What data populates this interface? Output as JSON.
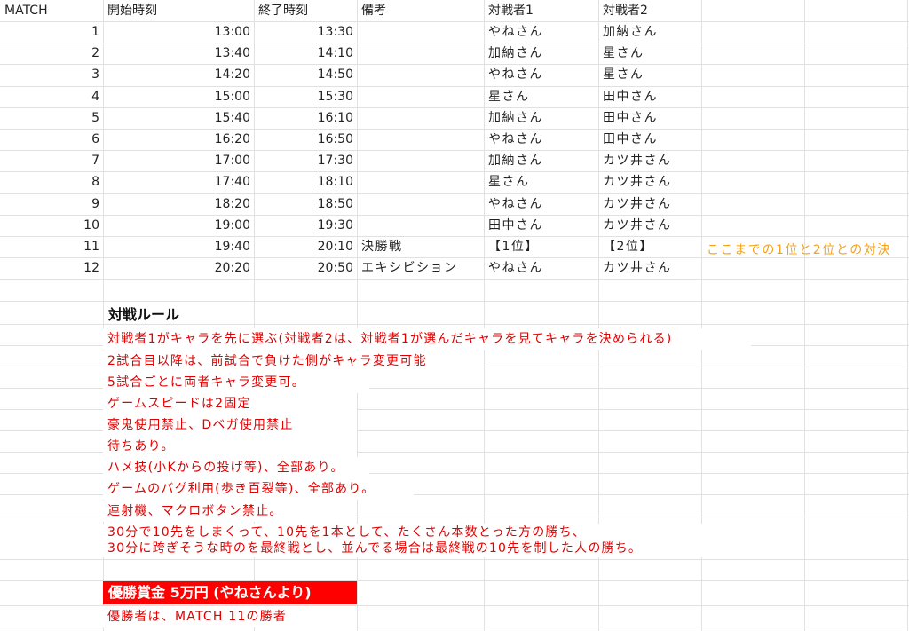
{
  "headers": [
    "MATCH",
    "開始時刻",
    "終了時刻",
    "備考",
    "対戦者1",
    "対戦者2"
  ],
  "matches": [
    {
      "no": "1",
      "start": "13:00",
      "end": "13:30",
      "note": "",
      "p1": "やねさん",
      "p2": "加納さん"
    },
    {
      "no": "2",
      "start": "13:40",
      "end": "14:10",
      "note": "",
      "p1": "加納さん",
      "p2": "星さん"
    },
    {
      "no": "3",
      "start": "14:20",
      "end": "14:50",
      "note": "",
      "p1": "やねさん",
      "p2": "星さん"
    },
    {
      "no": "4",
      "start": "15:00",
      "end": "15:30",
      "note": "",
      "p1": "星さん",
      "p2": "田中さん"
    },
    {
      "no": "5",
      "start": "15:40",
      "end": "16:10",
      "note": "",
      "p1": "加納さん",
      "p2": "田中さん"
    },
    {
      "no": "6",
      "start": "16:20",
      "end": "16:50",
      "note": "",
      "p1": "やねさん",
      "p2": "田中さん"
    },
    {
      "no": "7",
      "start": "17:00",
      "end": "17:30",
      "note": "",
      "p1": "加納さん",
      "p2": "カツ井さん"
    },
    {
      "no": "8",
      "start": "17:40",
      "end": "18:10",
      "note": "",
      "p1": "星さん",
      "p2": "カツ井さん"
    },
    {
      "no": "9",
      "start": "18:20",
      "end": "18:50",
      "note": "",
      "p1": "やねさん",
      "p2": "カツ井さん"
    },
    {
      "no": "10",
      "start": "19:00",
      "end": "19:30",
      "note": "",
      "p1": "田中さん",
      "p2": "カツ井さん"
    },
    {
      "no": "11",
      "start": "19:40",
      "end": "20:10",
      "note": "決勝戦",
      "p1": "【1位】",
      "p2": "【2位】"
    },
    {
      "no": "12",
      "start": "20:20",
      "end": "20:50",
      "note": "エキシビション",
      "p1": "やねさん",
      "p2": "カツ井さん"
    }
  ],
  "final_note": "ここまでの1位と2位との対決",
  "rules_heading": "対戦ルール",
  "rules": [
    "対戦者1がキャラを先に選ぶ(対戦者2は、対戦者1が選んだキャラを見てキャラを決められる)",
    "2試合目以降は、前試合で負けた側がキャラ変更可能",
    "5試合ごとに両者キャラ変更可。",
    "ゲームスピードは2固定",
    "豪鬼使用禁止、Dベガ使用禁止",
    "待ちあり。",
    "ハメ技(小Kからの投げ等)、全部あり。",
    "ゲームのバグ利用(歩き百裂等)、全部あり。",
    "連射機、マクロボタン禁止。",
    "30分で10先をしまくって、10先を1本として、たくさん本数とった方の勝ち、",
    "30分に跨ぎそうな時のを最終戦とし、並んでる場合は最終戦の10先を制した人の勝ち。"
  ],
  "prize_title": "優勝賞金 5万円 (やねさんより)",
  "prize_note": "優勝者は、MATCH 11の勝者",
  "colors": {
    "rule_text": "#e00000",
    "note_text": "#f4a21a",
    "prize_bg": "#ff0000",
    "grid": "#e1e1e1"
  }
}
